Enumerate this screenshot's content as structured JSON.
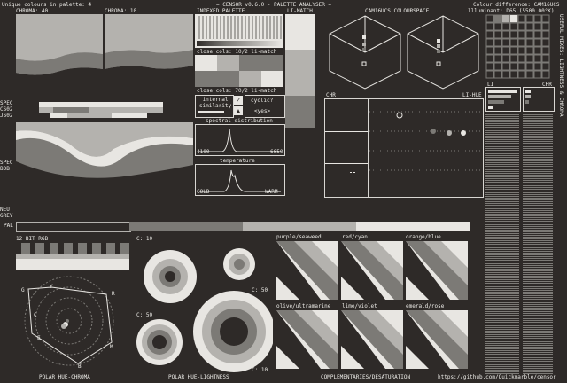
{
  "header": {
    "unique_colours": "Unique colours in palette: 4",
    "title": "= CENSOR v0.6.0 - PALETTE ANALYSER =",
    "colour_difference": "Colour difference: CAM16UCS",
    "illuminant": "Illuminant: D65 (5500.00°K)"
  },
  "labels": {
    "chroma_40": "CHROMA: 40",
    "chroma_10": "CHROMA: 10",
    "indexed_palette": "INDEXED PALETTE",
    "li_match": "LI-MATCH",
    "colourspace": "CAM16UCS COLOURSPACE",
    "close_cols_1": "close cols: 10/2 li-match",
    "close_cols_2": "close cols: 70/2 li-match",
    "internal_similarity": "internal similarity",
    "cyclic": "cyclic?",
    "yes": "<yes>",
    "spectral_distribution": "spectral distribution",
    "spec_min": "4100",
    "spec_max": "6650",
    "temperature": "temperature",
    "cold": "COLD",
    "warm": "WARM",
    "chr": "CHR",
    "li_hue": "LI-HUE",
    "li": "LI",
    "chr2": "CHR",
    "spec_cs02": "SPEC CS02 JS02",
    "spec_bdb": "SPEC BDB",
    "neu_grey": "NEU GREY",
    "pal": "PAL",
    "rgb_12bit": "12 BIT RGB",
    "c10_a": "C: 10",
    "c50_a": "C: 50",
    "c50_b": "C: 50",
    "c10_b": "C: 10",
    "useful_mixes": "USEFUL MIXES: LIGHTNESS & CHROMA",
    "polar_hue_chroma": "POLAR HUE-CHROMA",
    "polar_hue_lightness": "POLAR HUE-LIGHTNESS",
    "complementaries": "COMPLEMENTARIES/DESATURATION",
    "url": "https://github.com/Quickmarble/censor"
  },
  "polar_letters": [
    "G",
    "Y",
    "R",
    "M",
    "B",
    "C",
    "E"
  ],
  "complementaries": [
    {
      "name": "purple/seaweed"
    },
    {
      "name": "red/cyan"
    },
    {
      "name": "orange/blue"
    },
    {
      "name": "olive/ultramarine"
    },
    {
      "name": "lime/violet"
    },
    {
      "name": "emerald/rose"
    }
  ],
  "palette_colors": [
    "#2e2a28",
    "#7c7a76",
    "#b4b2ae",
    "#e8e6e2"
  ]
}
